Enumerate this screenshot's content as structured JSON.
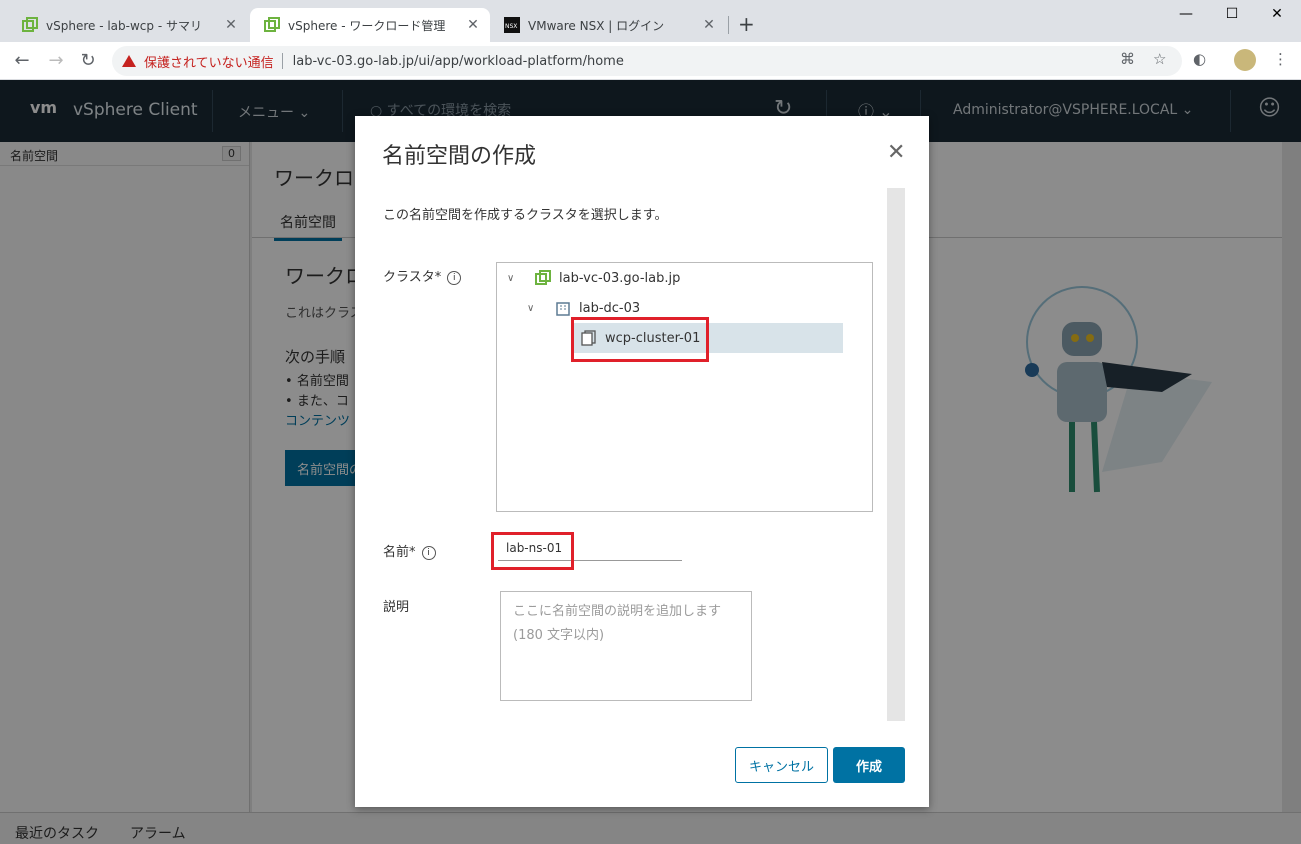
{
  "browser": {
    "tabs": [
      {
        "title": "vSphere - lab-wcp - サマリ",
        "favicon": "vsphere-icon"
      },
      {
        "title": "vSphere - ワークロード管理",
        "favicon": "vsphere-icon"
      },
      {
        "title": "VMware NSX | ログイン",
        "favicon": "nsx-icon"
      }
    ],
    "security_label": "保護されていない通信",
    "url": "lab-vc-03.go-lab.jp/ui/app/workload-platform/home"
  },
  "app": {
    "logo": "vm",
    "title": "vSphere Client",
    "menu_label": "メニュー",
    "search_placeholder": "すべての環境を検索",
    "user": "Administrator@VSPHERE.LOCAL"
  },
  "sidebar": {
    "header": "名前空間",
    "count": "0"
  },
  "background": {
    "page_title": "ワークロ",
    "tab": "名前空間",
    "heading": "ワークロ",
    "body": "これはクラス",
    "next_steps": "次の手順",
    "bullets": [
      "名前空間",
      "また、コ"
    ],
    "link": "コンテンツ",
    "button": "名前空間の"
  },
  "bottom": {
    "tasks": "最近のタスク",
    "alarms": "アラーム"
  },
  "modal": {
    "title": "名前空間の作成",
    "intro": "この名前空間を作成するクラスタを選択します。",
    "cluster_label": "クラスタ",
    "tree": [
      {
        "label": "lab-vc-03.go-lab.jp",
        "icon": "vcenter-icon"
      },
      {
        "label": "lab-dc-03",
        "icon": "datacenter-icon"
      },
      {
        "label": "wcp-cluster-01",
        "icon": "cluster-icon"
      }
    ],
    "name_label": "名前",
    "name_value": "lab-ns-01",
    "desc_label": "説明",
    "desc_placeholder_1": "ここに名前空間の説明を追加します",
    "desc_placeholder_2": "(180 文字以内)",
    "cancel": "キャンセル",
    "create": "作成"
  }
}
